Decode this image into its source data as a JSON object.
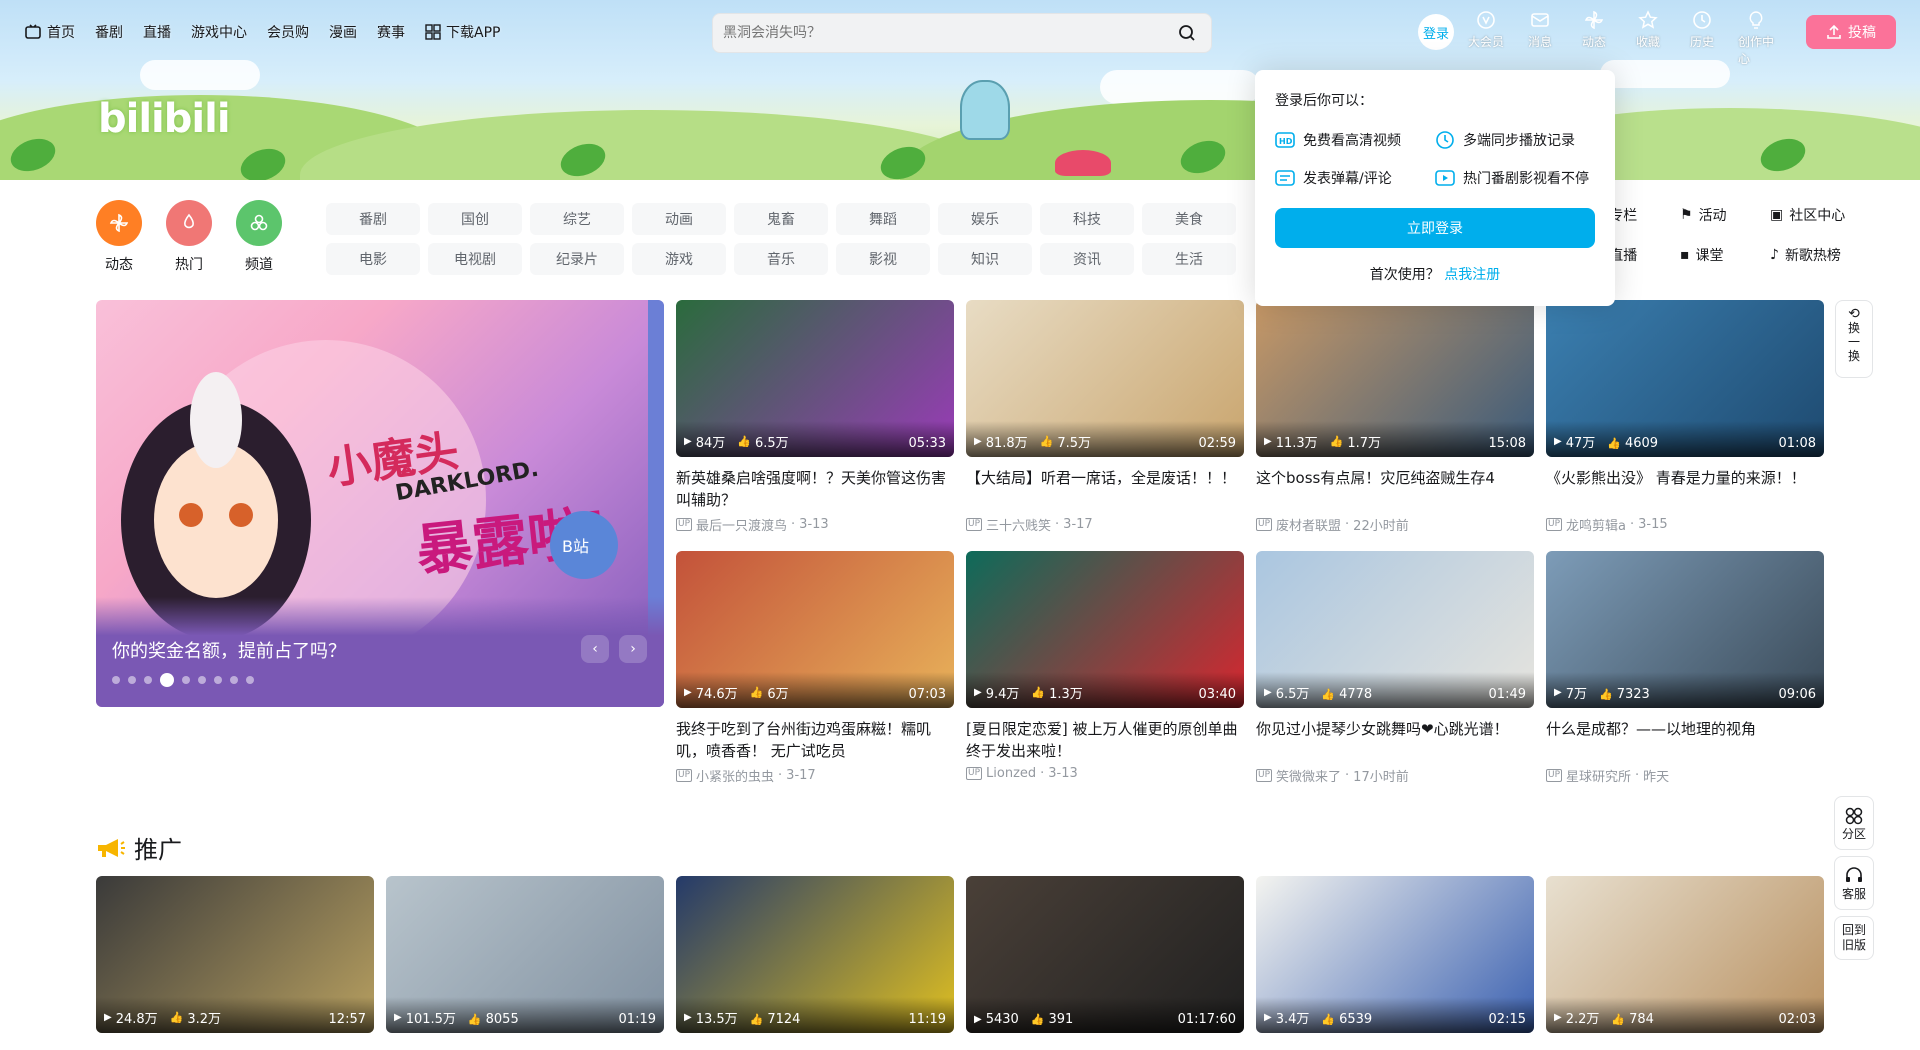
{
  "topnav": {
    "items": [
      "首页",
      "番剧",
      "直播",
      "游戏中心",
      "会员购",
      "漫画",
      "赛事"
    ],
    "download": "下载APP",
    "search_placeholder": "黑洞会消失吗？",
    "login": "登录",
    "right": [
      "大会员",
      "消息",
      "动态",
      "收藏",
      "历史",
      "创作中心"
    ],
    "post": "投稿"
  },
  "logo": "bilibili",
  "channels": [
    {
      "label": "动态",
      "color": "#ff7f24"
    },
    {
      "label": "热门",
      "color": "#f07775"
    },
    {
      "label": "频道",
      "color": "#5cc56c"
    }
  ],
  "tags_row1": [
    "番剧",
    "国创",
    "综艺",
    "动画",
    "鬼畜",
    "舞蹈",
    "娱乐",
    "科技",
    "美食"
  ],
  "tags_row2": [
    "电影",
    "电视剧",
    "纪录片",
    "游戏",
    "音乐",
    "影视",
    "知识",
    "资讯",
    "生活"
  ],
  "side_links": [
    "专栏",
    "活动",
    "社区中心",
    "直播",
    "课堂",
    "新歌热榜"
  ],
  "carousel": {
    "title": "你的奖金名额，提前占了吗？"
  },
  "popup": {
    "title": "登录后你可以：",
    "features": [
      "免费看高清视频",
      "多端同步播放记录",
      "发表弹幕/评论",
      "热门番剧影视看不停"
    ],
    "login_button": "立即登录",
    "register_prompt": "首次使用？",
    "register_link": "点我注册"
  },
  "refresh": [
    "换",
    "一",
    "换"
  ],
  "side_tools": [
    [
      "分区"
    ],
    [
      "客服"
    ],
    [
      "回到",
      "旧版"
    ]
  ],
  "promo": {
    "title": "推广"
  },
  "videos": [
    {
      "plays": "84万",
      "likes": "6.5万",
      "duration": "05:33",
      "title": "新英雄桑启啥强度啊！？天美你管这伤害叫辅助？",
      "up": "最后一只渡渡鸟",
      "date": "3-13",
      "c1": "#2a6b3c",
      "c2": "#9a3bb8"
    },
    {
      "plays": "81.8万",
      "likes": "7.5万",
      "duration": "02:59",
      "title": "【大结局】听君一席话，全是废话！！！",
      "up": "三十六贱笑",
      "date": "3-17",
      "c1": "#e8dcc4",
      "c2": "#c9a56e"
    },
    {
      "plays": "11.3万",
      "likes": "1.7万",
      "duration": "15:08",
      "title": "这个boss有点屌！灾厄纯盗贼生存4",
      "up": "废材者联盟",
      "date": "22小时前",
      "c1": "#c79866",
      "c2": "#3a5a7a"
    },
    {
      "plays": "47万",
      "likes": "4609",
      "duration": "01:08",
      "title": "《火影熊出没》 青春是力量的来源！！",
      "up": "龙鸣剪辑a",
      "date": "3-15",
      "c1": "#3b7fb0",
      "c2": "#1e4a70"
    },
    {
      "plays": "74.6万",
      "likes": "6万",
      "duration": "07:03",
      "title": "我终于吃到了台州街边鸡蛋麻糍！糯叽叽，喷香香！ 无广试吃员",
      "up": "小紧张的虫虫",
      "date": "3-17",
      "c1": "#c3523a",
      "c2": "#e8b25a"
    },
    {
      "plays": "9.4万",
      "likes": "1.3万",
      "duration": "03:40",
      "title": "[夏日限定恋爱] 被上万人催更的原创单曲终于发出来啦！",
      "up": "Lionzed",
      "date": "3-13",
      "c1": "#0d6b5a",
      "c2": "#d8262f"
    },
    {
      "plays": "6.5万",
      "likes": "4778",
      "duration": "01:49",
      "title": "你见过小提琴少女跳舞吗❤心跳光谱！",
      "up": "笑微微来了",
      "date": "17小时前",
      "c1": "#aac6e0",
      "c2": "#e6e4de"
    },
    {
      "plays": "7万",
      "likes": "7323",
      "duration": "09:06",
      "title": "什么是成都？——以地理的视角",
      "up": "星球研究所",
      "date": "昨天",
      "c1": "#7d9cb8",
      "c2": "#3a4a58"
    }
  ],
  "promo_videos": [
    {
      "plays": "24.8万",
      "likes": "3.2万",
      "duration": "12:57",
      "c1": "#3a3a3a",
      "c2": "#b8a060"
    },
    {
      "plays": "101.5万",
      "likes": "8055",
      "duration": "01:19",
      "c1": "#b8c4cc",
      "c2": "#8090a0"
    },
    {
      "plays": "13.5万",
      "likes": "7124",
      "duration": "11:19",
      "c1": "#243a6a",
      "c2": "#e0c020"
    },
    {
      "plays": "5430",
      "likes": "391",
      "duration": "01:17:60",
      "c1": "#4a4038",
      "c2": "#202020"
    },
    {
      "plays": "3.4万",
      "likes": "6539",
      "duration": "02:15",
      "c1": "#f4f4f0",
      "c2": "#3a60b0"
    },
    {
      "plays": "2.2万",
      "likes": "784",
      "duration": "02:03",
      "c1": "#e8e0d0",
      "c2": "#b89060"
    }
  ]
}
